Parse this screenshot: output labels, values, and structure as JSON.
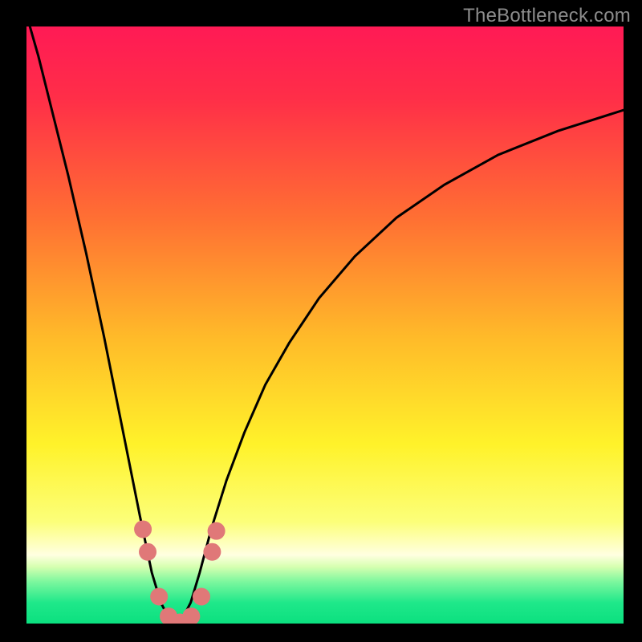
{
  "watermark": "TheBottleneck.com",
  "colors": {
    "frame": "#000000",
    "marker_fill": "#e07878",
    "curve_stroke": "#000000"
  },
  "chart_data": {
    "type": "line",
    "title": "",
    "xlabel": "",
    "ylabel": "",
    "xlim": [
      0,
      1
    ],
    "ylim": [
      0,
      1
    ],
    "gradient_stops": [
      {
        "t": 0.0,
        "color": "#ff1a55"
      },
      {
        "t": 0.12,
        "color": "#ff2e48"
      },
      {
        "t": 0.32,
        "color": "#ff6f33"
      },
      {
        "t": 0.52,
        "color": "#ffba29"
      },
      {
        "t": 0.7,
        "color": "#fff22a"
      },
      {
        "t": 0.83,
        "color": "#fcff7a"
      },
      {
        "t": 0.885,
        "color": "#ffffe1"
      },
      {
        "t": 0.905,
        "color": "#d6ffb0"
      },
      {
        "t": 0.93,
        "color": "#7cf79e"
      },
      {
        "t": 0.965,
        "color": "#1fe88a"
      },
      {
        "t": 1.0,
        "color": "#0be07f"
      }
    ],
    "series": [
      {
        "name": "bottleneck-curve",
        "x": [
          0.0,
          0.02,
          0.04,
          0.07,
          0.1,
          0.13,
          0.16,
          0.19,
          0.21,
          0.225,
          0.238,
          0.25,
          0.262,
          0.275,
          0.29,
          0.31,
          0.335,
          0.365,
          0.4,
          0.44,
          0.49,
          0.55,
          0.62,
          0.7,
          0.79,
          0.89,
          1.0
        ],
        "y": [
          1.02,
          0.95,
          0.87,
          0.75,
          0.62,
          0.48,
          0.33,
          0.18,
          0.085,
          0.035,
          0.01,
          0.0,
          0.01,
          0.035,
          0.085,
          0.16,
          0.24,
          0.32,
          0.4,
          0.47,
          0.545,
          0.615,
          0.68,
          0.735,
          0.785,
          0.825,
          0.86
        ]
      }
    ],
    "markers": [
      {
        "x": 0.195,
        "y": 0.158
      },
      {
        "x": 0.203,
        "y": 0.12
      },
      {
        "x": 0.222,
        "y": 0.045
      },
      {
        "x": 0.238,
        "y": 0.012
      },
      {
        "x": 0.257,
        "y": 0.002
      },
      {
        "x": 0.276,
        "y": 0.012
      },
      {
        "x": 0.293,
        "y": 0.045
      },
      {
        "x": 0.311,
        "y": 0.12
      },
      {
        "x": 0.318,
        "y": 0.155
      }
    ]
  }
}
